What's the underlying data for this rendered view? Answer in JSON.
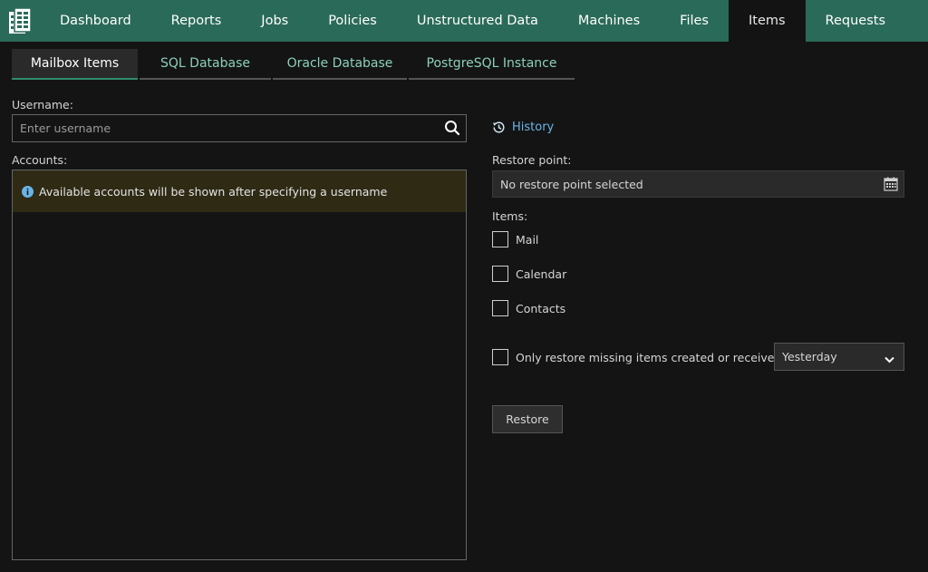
{
  "nav": {
    "items": [
      "Dashboard",
      "Reports",
      "Jobs",
      "Policies",
      "Unstructured Data",
      "Machines",
      "Files",
      "Items",
      "Requests"
    ],
    "active": "Items"
  },
  "tabs": [
    "Mailbox Items",
    "SQL Database",
    "Oracle Database",
    "PostgreSQL Instance"
  ],
  "username": {
    "label": "Username:",
    "placeholder": "Enter username",
    "value": ""
  },
  "accounts": {
    "label": "Accounts:",
    "info": "Available accounts will be shown after specifying a username"
  },
  "history": {
    "label": "History"
  },
  "restore_point": {
    "label": "Restore point:",
    "value": "No restore point selected"
  },
  "items": {
    "label": "Items:",
    "options": [
      "Mail",
      "Calendar",
      "Contacts"
    ]
  },
  "only_missing": {
    "label": "Only restore missing items created or received",
    "select_value": "Yesterday"
  },
  "restore_button": "Restore",
  "colors": {
    "nav_bg": "#2a6a58",
    "accent": "#2e8b6c",
    "link": "#6ab4e6",
    "info_bg": "#2e2a14"
  },
  "icons": [
    "app-logo-icon",
    "search-icon",
    "history-icon",
    "calendar-icon",
    "info-icon",
    "chevron-down-icon"
  ]
}
